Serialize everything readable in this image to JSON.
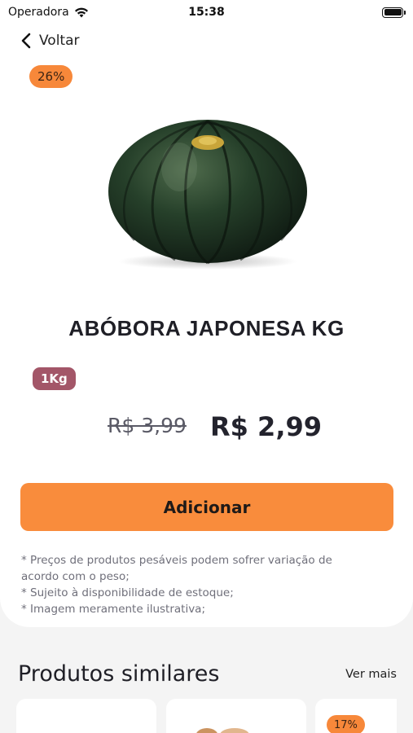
{
  "status_bar": {
    "carrier": "Operadora",
    "time": "15:38"
  },
  "nav": {
    "back_label": "Voltar"
  },
  "product": {
    "discount": "26%",
    "title": "ABÓBORA JAPONESA KG",
    "weight": "1Kg",
    "old_price": "R$ 3,99",
    "new_price": "R$ 2,99",
    "add_label": "Adicionar",
    "notes": [
      "* Preços de produtos pesáveis podem sofrer variação de acordo com o peso;",
      "* Sujeito à disponibilidade de estoque;",
      "* Imagem meramente ilustrativa;"
    ]
  },
  "similar": {
    "title": "Produtos similares",
    "see_more": "Ver mais",
    "items": [
      {
        "discount": ""
      },
      {
        "discount": ""
      },
      {
        "discount": "17%"
      }
    ]
  },
  "colors": {
    "accent": "#f98c3c",
    "weight_tag": "#a35668",
    "background": "#f4f4f4"
  }
}
